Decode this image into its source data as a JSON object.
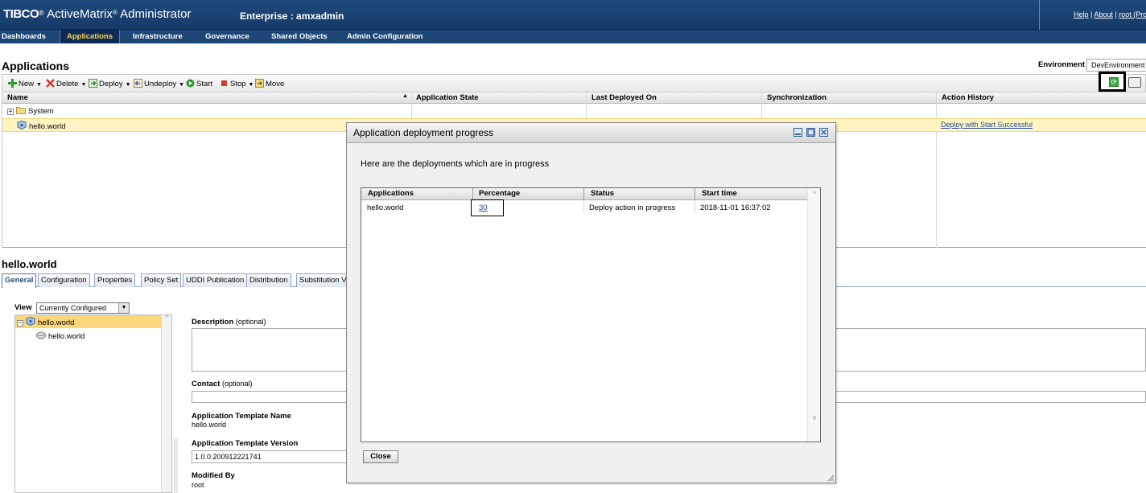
{
  "header": {
    "logo_brand": "TIBCO",
    "logo_product": "ActiveMatrix",
    "logo_suffix": "Administrator",
    "enterprise": "Enterprise : amxadmin",
    "links": {
      "help": "Help",
      "sep1": "|",
      "about": "About",
      "sep2": "|",
      "user": "root (Profi"
    }
  },
  "nav": {
    "items": [
      {
        "label": "Dashboards",
        "active": false
      },
      {
        "label": "Applications",
        "active": true
      },
      {
        "label": "Infrastructure",
        "active": false
      },
      {
        "label": "Governance",
        "active": false
      },
      {
        "label": "Shared Objects",
        "active": false
      },
      {
        "label": "Admin Configuration",
        "active": false
      }
    ]
  },
  "page": {
    "title": "Applications",
    "environment_label": "Environment",
    "environment_value": "DevEnvironment"
  },
  "toolbar": {
    "new": "New",
    "delete": "Delete",
    "deploy": "Deploy",
    "undeploy": "Undeploy",
    "start": "Start",
    "stop": "Stop",
    "move": "Move",
    "refresh_icon": "refresh-icon",
    "config_icon": "config-icon"
  },
  "grid": {
    "columns": [
      "Name",
      "Application State",
      "Last Deployed On",
      "Synchronization",
      "Action History"
    ],
    "sort_indicator": "▲",
    "rows": [
      {
        "name": "System",
        "action_history": ""
      },
      {
        "name": "hello.world",
        "action_history": "Deploy with Start Successful"
      }
    ]
  },
  "detail": {
    "title": "hello.world",
    "tabs": [
      "General",
      "Configuration",
      "Properties",
      "Policy Set",
      "UDDI Publication",
      "Distribution",
      "Substitution V"
    ],
    "view_label": "View",
    "view_value": "Currently Configured",
    "tree": {
      "root": "hello.world",
      "child": "hello.world"
    },
    "fields": {
      "description_label": "Description",
      "description_opt": "(optional)",
      "contact_label": "Contact",
      "contact_opt": "(optional)",
      "template_name_label": "Application Template Name",
      "template_name_value": "hello.world",
      "template_version_label": "Application Template Version",
      "template_version_value": "1.0.0.200912221741",
      "modified_by_label": "Modified By",
      "modified_by_value": "root"
    }
  },
  "modal": {
    "title": "Application deployment progress",
    "intro": "Here are the deployments which are in progress",
    "columns": [
      "Applications",
      "Percentage",
      "Status",
      "Start time"
    ],
    "rows": [
      {
        "application": "hello.world",
        "percentage": "30",
        "status": "Deploy action in progress",
        "start_time": "2018-11-01 16:37:02"
      }
    ],
    "close_label": "Close"
  },
  "colors": {
    "header_bg": "#1f4a7e",
    "nav_active": "#ffd24a",
    "selected_row": "#fff4c2",
    "link": "#224b9a"
  }
}
